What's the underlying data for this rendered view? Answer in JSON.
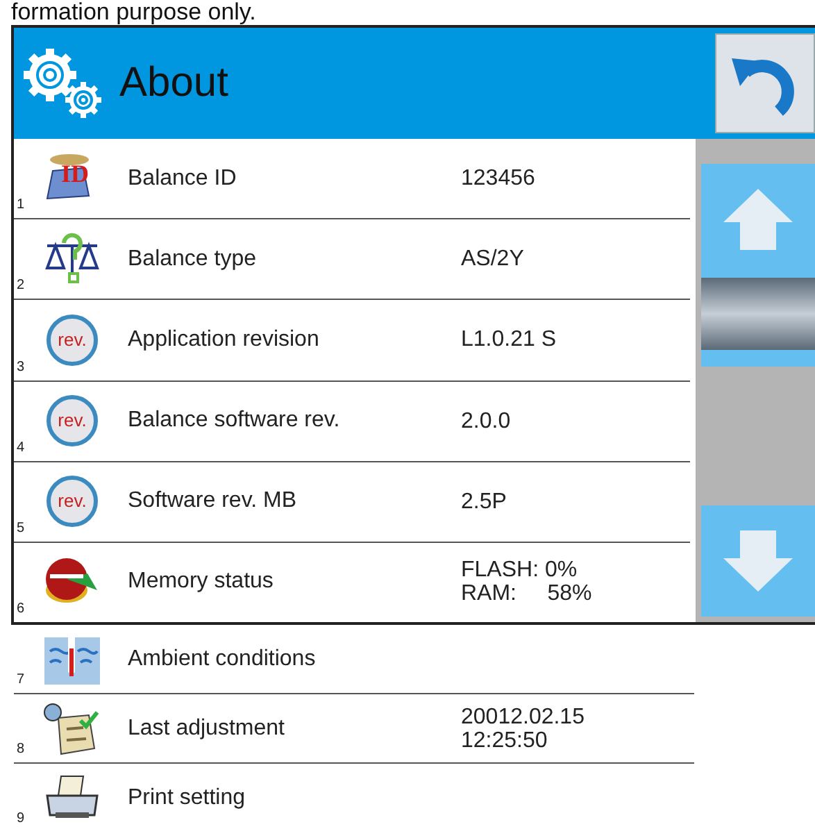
{
  "caption": "formation purpose only.",
  "window": {
    "title": "About"
  },
  "rows": [
    {
      "number": "1",
      "kind": "id",
      "icon_text": "ID",
      "label": "Balance ID",
      "value": [
        "123456"
      ]
    },
    {
      "number": "2",
      "kind": "balance",
      "label": "Balance type",
      "value": [
        "AS/2Y"
      ]
    },
    {
      "number": "3",
      "kind": "rev",
      "icon_text": "rev.",
      "label": "Application revision",
      "value": [
        "L1.0.21 S"
      ]
    },
    {
      "number": "4",
      "kind": "rev",
      "icon_text": "rev.",
      "label": "Balance software rev.",
      "value": [
        "2.0.0"
      ]
    },
    {
      "number": "5",
      "kind": "rev",
      "icon_text": "rev.",
      "label": "Software rev.  MB",
      "value": [
        "2.5P"
      ]
    },
    {
      "number": "6",
      "kind": "memory",
      "label": "Memory status",
      "value": [
        "FLASH: 0%",
        "RAM:     58%"
      ]
    }
  ],
  "below_rows": [
    {
      "number": "7",
      "kind": "ambient",
      "label": "Ambient conditions",
      "value": []
    },
    {
      "number": "8",
      "kind": "calendar",
      "label": "Last adjustment",
      "value": [
        "20012.02.15",
        "12:25:50"
      ]
    },
    {
      "number": "9",
      "kind": "printer",
      "label": "Print setting",
      "value": []
    }
  ]
}
